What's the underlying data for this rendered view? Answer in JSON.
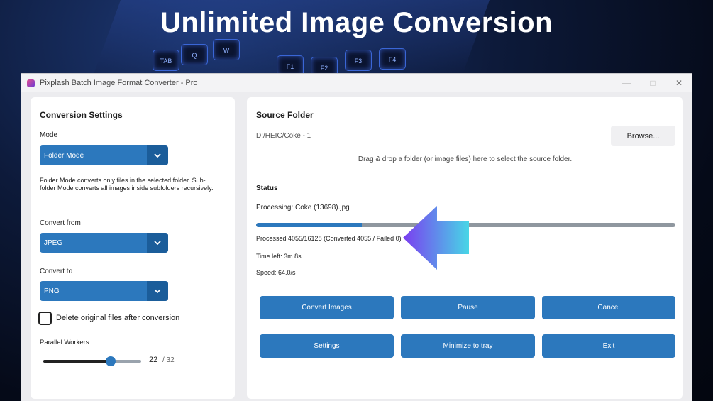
{
  "headline": "Unlimited Image Conversion",
  "background": {
    "keys": [
      "TAB",
      "Q",
      "W",
      "F1",
      "F2",
      "F3",
      "F4"
    ]
  },
  "window": {
    "title": "Pixplash Batch Image Format Converter - Pro",
    "controls": [
      "—",
      "□",
      "✕"
    ]
  },
  "settings": {
    "title": "Conversion Settings",
    "mode_label": "Mode",
    "mode_value": "Folder Mode",
    "mode_description": "Folder Mode converts only files in the selected folder. Sub-folder Mode converts all images inside subfolders recursively.",
    "convert_from_label": "Convert from",
    "convert_from_value": "JPEG",
    "convert_to_label": "Convert to",
    "convert_to_value": "PNG",
    "delete_original_label": "Delete original files after conversion",
    "delete_original_checked": false,
    "parallel_workers_label": "Parallel Workers",
    "parallel_workers_value": "22",
    "parallel_workers_max": "/ 32",
    "parallel_workers_fraction": 0.6875
  },
  "source": {
    "title": "Source Folder",
    "path": "D:/HEIC/Coke - 1",
    "browse_label": "Browse...",
    "hint": "Drag & drop a folder (or image files) here to select the source folder."
  },
  "status": {
    "title": "Status",
    "processing": "Processing: Coke (13698).jpg",
    "progress_fraction": 0.2514,
    "processed": "Processed 4055/16128 (Converted 4055 / Failed 0)",
    "time_left": "Time left: 3m 8s",
    "speed": "Speed: 64.0/s"
  },
  "buttons": {
    "convert": "Convert Images",
    "pause": "Pause",
    "cancel": "Cancel",
    "settings": "Settings",
    "minimize": "Minimize to tray",
    "exit": "Exit"
  },
  "colors": {
    "accent": "#2c78bd",
    "accent_dark": "#1b5d9a",
    "arrow_start": "#7b3df0",
    "arrow_end": "#47d6e6"
  }
}
